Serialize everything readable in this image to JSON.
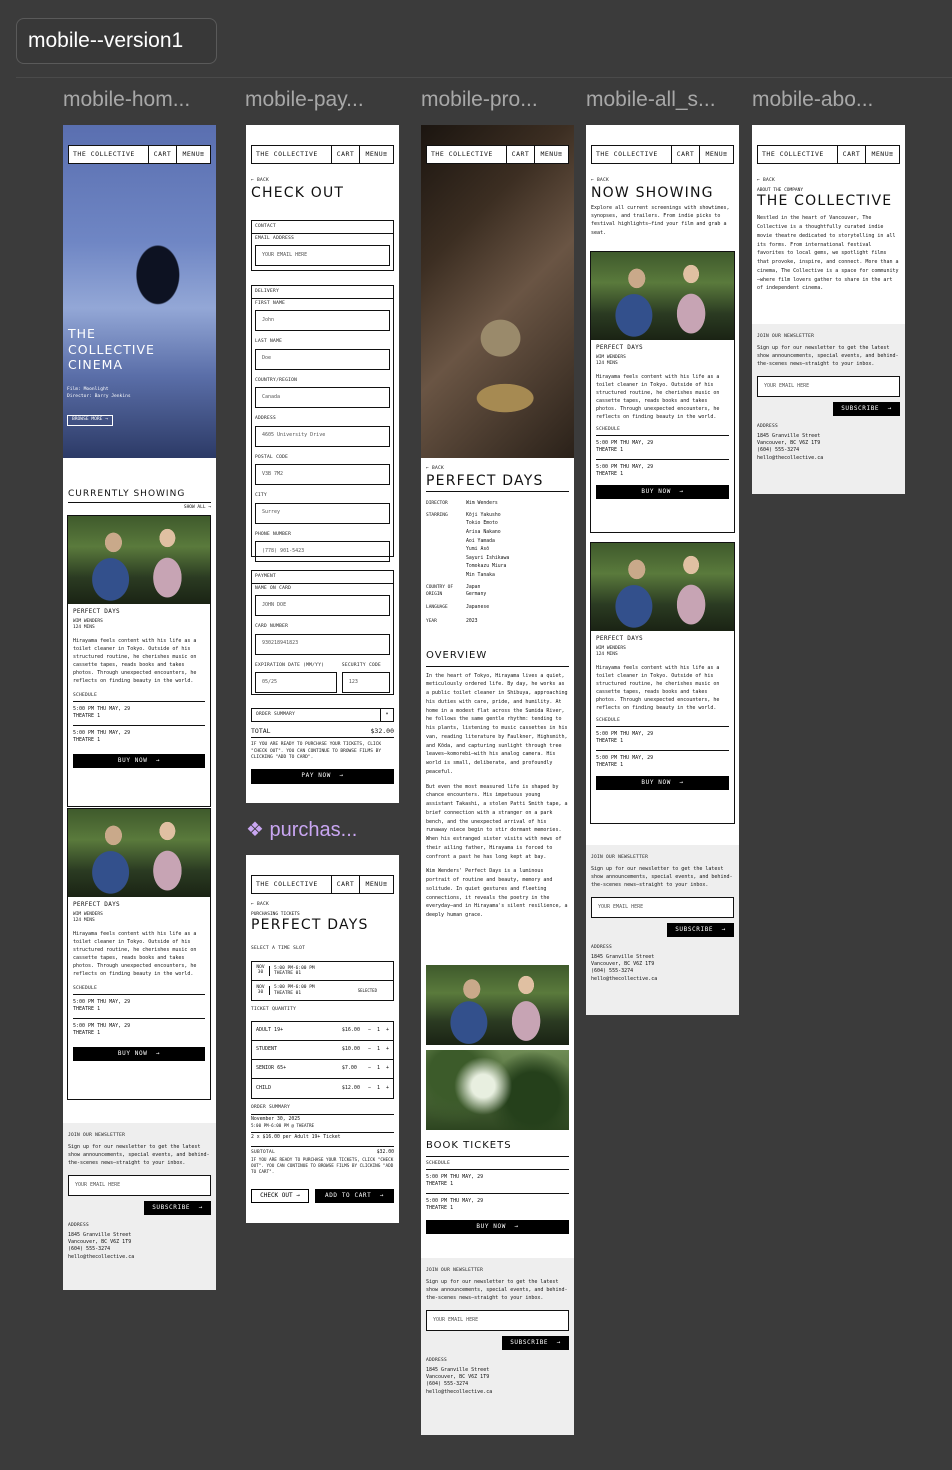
{
  "canvas": {
    "page_label": "mobile--version1",
    "frames": [
      "mobile-hom...",
      "mobile-pay...",
      "mobile-pro...",
      "mobile-all_s...",
      "mobile-abo..."
    ],
    "section_purchase": "purchas...",
    "section_icon": "component-icon"
  },
  "nav": {
    "brand": "THE COLLECTIVE",
    "cart": "CART",
    "menu": "MENU"
  },
  "common": {
    "back": "BACK",
    "buy_now": "BUY NOW",
    "arrow": "→",
    "schedule": "SCHEDULE",
    "showings": [
      {
        "when": "5:00 PM THU MAY, 29",
        "where": "THEATRE 1"
      },
      {
        "when": "5:00 PM THU MAY, 29",
        "where": "THEATRE 1"
      }
    ]
  },
  "film": {
    "title": "PERFECT DAYS",
    "director_line": "WIM WENDERS",
    "runtime": "124 MINS",
    "synopsis": "Hirayama feels content with his life as a toilet cleaner in Tokyo. Outside of his structured routine, he cherishes music on cassette tapes, reads books and takes photos. Through unexpected encounters, he reflects on finding beauty in the world."
  },
  "home": {
    "hero_title": [
      "THE",
      "COLLECTIVE",
      "CINEMA"
    ],
    "hero_film": "Film: Moonlight",
    "hero_director": "Director: Barry Jenkins",
    "browse_more": "BROWSE MORE",
    "currently_showing": "CURRENTLY SHOWING",
    "show_all": "SHOW ALL"
  },
  "newsletter": {
    "title": "JOIN OUR NEWSLETTER",
    "text": "Sign up for our newsletter to get the latest show announcements, special events, and behind-the-scenes news—straight to your inbox.",
    "placeholder": "YOUR EMAIL HERE",
    "subscribe": "SUBSCRIBE",
    "address_label": "ADDRESS",
    "address": [
      "1845 Granville Street",
      "Vancouver, BC V6Z 1T9",
      "(604) 555-3274",
      "hello@thecollective.ca"
    ]
  },
  "checkout": {
    "title": "CHECK OUT",
    "contact": "CONTACT",
    "email_label": "EMAIL ADDRESS",
    "email_ph": "YOUR EMAIL HERE",
    "delivery": "DELIVERY",
    "first_label": "FIRST NAME",
    "first_val": "John",
    "last_label": "LAST NAME",
    "last_val": "Doe",
    "country_label": "COUNTRY/REGION",
    "country_val": "Canada",
    "address_label": "ADDRESS",
    "address_val": "4605 University Drive",
    "postal_label": "POSTAL CODE",
    "postal_val": "V3B 7M2",
    "city_label": "CITY",
    "city_val": "Surrey",
    "phone_label": "PHONE NUMBER",
    "phone_val": "(778) 901-5423",
    "payment": "PAYMENT",
    "card_name_label": "NAME ON CARD",
    "card_name_val": "JOHN DOE",
    "card_num_label": "CARD NUMBER",
    "card_num_val": "930218941823",
    "exp_label": "EXPIRATION DATE (MM/YY)",
    "exp_val": "05/25",
    "sec_label": "SECURITY CODE",
    "sec_val": "123",
    "order_summary": "ORDER SUMMARY",
    "total_label": "TOTAL",
    "total_val": "$32.00",
    "note": "IF YOU ARE READY TO PURCHASE YOUR TICKETS, CLICK \"CHECK OUT\". YOU CAN CONTINUE TO BROWSE FILMS BY CLICKING \"ADD TO CARD\".",
    "pay_now": "PAY NOW"
  },
  "purchase": {
    "kicker": "PURCHASING TICKETS",
    "title": "PERFECT DAYS",
    "select_slot": "SELECT A TIME SLOT",
    "slots": [
      {
        "mon": "NOV",
        "day": "30",
        "time": "5:00 PM-6:00 PM",
        "theatre": "THEATRE 01",
        "tag": ""
      },
      {
        "mon": "NOV",
        "day": "30",
        "time": "5:00 PM-6:00 PM",
        "theatre": "THEATRE 01",
        "tag": "SELECTED"
      }
    ],
    "ticket_qty": "TICKET QUANTITY",
    "tickets": [
      {
        "type": "ADULT 19+",
        "price": "$16.00",
        "qty": "1"
      },
      {
        "type": "STUDENT",
        "price": "$10.00",
        "qty": "1"
      },
      {
        "type": "SENIOR 65+",
        "price": "$7.00",
        "qty": "1"
      },
      {
        "type": "CHILD",
        "price": "$12.00",
        "qty": "1"
      }
    ],
    "order_summary": "ORDER SUMMARY",
    "order_date": "November 30, 2025",
    "order_time": "5:00 PM-6:00 PM @ THEATRE",
    "order_line": "2 x $16.00 per Adult 19+ Ticket",
    "subtotal_label": "SUBTOTAL",
    "subtotal_val": "$32.00",
    "note": "IF YOU ARE READY TO PURCHASE YOUR TICKETS, CLICK \"CHECK OUT\". YOU CAN CONTINUE TO BROWSE FILMS BY CLICKING \"ADD TO CART\".",
    "checkout_btn": "CHECK OUT",
    "add_cart_btn": "ADD TO CART"
  },
  "product": {
    "details": [
      {
        "k": "DIRECTOR",
        "v": "Wim Wenders"
      },
      {
        "k": "STARRING",
        "v": "Kōji Yakusho\nTokio Emoto\nArisa Nakano\nAoi Yamada\nYumi Asō\nSayuri Ishikawa\nTomokazu Miura\nMin Tanaka"
      },
      {
        "k": "COUNTRY OF ORIGIN",
        "v": "Japan\nGermany"
      },
      {
        "k": "LANGUAGE",
        "v": "Japanese"
      },
      {
        "k": "YEAR",
        "v": "2023"
      }
    ],
    "overview": "OVERVIEW",
    "p1": "In the heart of Tokyo, Hirayama lives a quiet, meticulously ordered life. By day, he works as a public toilet cleaner in Shibuya, approaching his duties with care, pride, and humility. At home in a modest flat across the Sumida River, he follows the same gentle rhythm: tending to his plants, listening to music cassettes in his van, reading literature by Faulkner, Highsmith, and Kōda, and capturing sunlight through tree leaves—komorebi—with his analog camera. His world is small, deliberate, and profoundly peaceful.",
    "p2": "But even the most measured life is shaped by chance encounters. His impetuous young assistant Takashi, a stolen Patti Smith tape, a brief connection with a stranger on a park bench, and the unexpected arrival of his runaway niece begin to stir dormant memories. When his estranged sister visits with news of their ailing father, Hirayama is forced to confront a past he has long kept at bay.",
    "p3": "Wim Wenders' Perfect Days is a luminous portrait of routine and beauty, memory and solitude. In quiet gestures and fleeting connections, it reveals the poetry in the everyday—and in Hirayama's silent resilience, a deeply human grace.",
    "book_tickets": "BOOK TICKETS"
  },
  "all_showing": {
    "title": "NOW SHOWING",
    "intro": "Explore all current screenings with showtimes, synopses, and trailers. From indie picks to festival highlights—find your film and grab a seat."
  },
  "about": {
    "kicker": "ABOUT THE COMPANY",
    "title": "THE COLLECTIVE",
    "text": "Nestled in the heart of Vancouver, The Collective is a thoughtfully curated indie movie theatre dedicated to storytelling in all its forms. From international festival favorites to local gems, we spotlight films that provoke, inspire, and connect. More than a cinema, The Collective is a space for community—where film lovers gather to share in the art of independent cinema."
  }
}
